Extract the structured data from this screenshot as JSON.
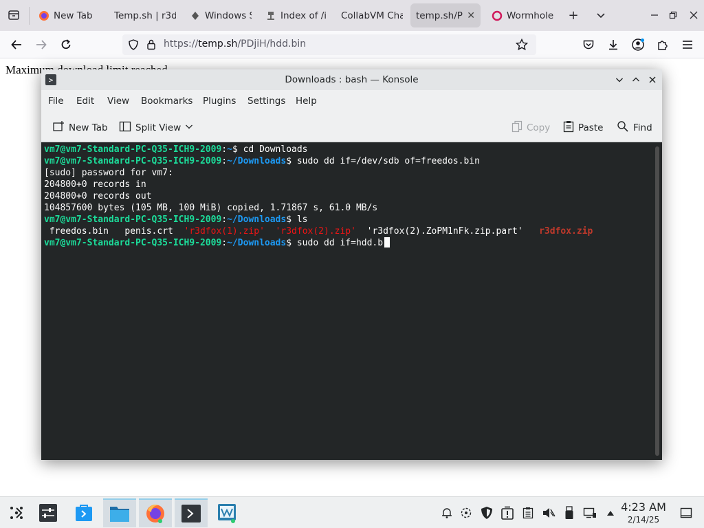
{
  "browser": {
    "tabs": [
      {
        "label": "New Tab",
        "favicon": "firefox-icon",
        "active": false
      },
      {
        "label": "Temp.sh | r3d",
        "favicon": "none",
        "active": false
      },
      {
        "label": "Windows S",
        "favicon": "windows-icon",
        "active": false
      },
      {
        "label": "Index of /i",
        "favicon": "index-icon",
        "active": false
      },
      {
        "label": "CollabVM Cha",
        "favicon": "none",
        "active": false
      },
      {
        "label": "temp.sh/PD",
        "favicon": "none",
        "active": true
      },
      {
        "label": "Wormhole",
        "favicon": "wormhole-icon",
        "active": false
      }
    ],
    "url": {
      "prefix": "https://",
      "domain": "temp.sh",
      "path": "/PDjiH/hdd.bin"
    }
  },
  "page": {
    "text": "Maximum download limit reached"
  },
  "konsole": {
    "title": "Downloads : bash — Konsole",
    "menus": [
      "File",
      "Edit",
      "View",
      "Bookmarks",
      "Plugins",
      "Settings",
      "Help"
    ],
    "toolbar": {
      "new_tab": "New Tab",
      "split_view": "Split View",
      "copy": "Copy",
      "paste": "Paste",
      "find": "Find"
    },
    "terminal": {
      "prompt_user": "vm7@vm7-Standard-PC-Q35-ICH9-2009",
      "lines": [
        {
          "type": "prompt",
          "path": "~",
          "cmd": " cd Downloads"
        },
        {
          "type": "prompt",
          "path": "~/Downloads",
          "cmd": " sudo dd if=/dev/sdb of=freedos.bin"
        },
        {
          "type": "out",
          "text": "[sudo] password for vm7:"
        },
        {
          "type": "out",
          "text": "204800+0 records in"
        },
        {
          "type": "out",
          "text": "204800+0 records out"
        },
        {
          "type": "out",
          "text": "104857600 bytes (105 MB, 100 MiB) copied, 1.71867 s, 61.0 MB/s"
        },
        {
          "type": "prompt",
          "path": "~/Downloads",
          "cmd": " ls"
        }
      ],
      "ls_items": [
        {
          "text": " freedos.bin",
          "style": "plain"
        },
        {
          "text": "   penis.crt",
          "style": "plain"
        },
        {
          "text": "  'r3dfox(1).zip'",
          "style": "red"
        },
        {
          "text": "  'r3dfox(2).zip'",
          "style": "red"
        },
        {
          "text": "  'r3dfox(2).ZoPM1nFk.zip.part'",
          "style": "plain"
        },
        {
          "text": "   r3dfox.zip",
          "style": "redbold"
        }
      ],
      "current": {
        "path": "~/Downloads",
        "cmd": " sudo dd if=hdd.b"
      }
    }
  },
  "taskbar": {
    "apps": [
      "app-launcher-icon",
      "system-settings-icon",
      "discover-icon",
      "dolphin-icon",
      "firefox-icon",
      "konsole-icon",
      "virtual-machine-icon"
    ],
    "clock": {
      "time": "4:23 AM",
      "date": "2/14/25"
    }
  }
}
